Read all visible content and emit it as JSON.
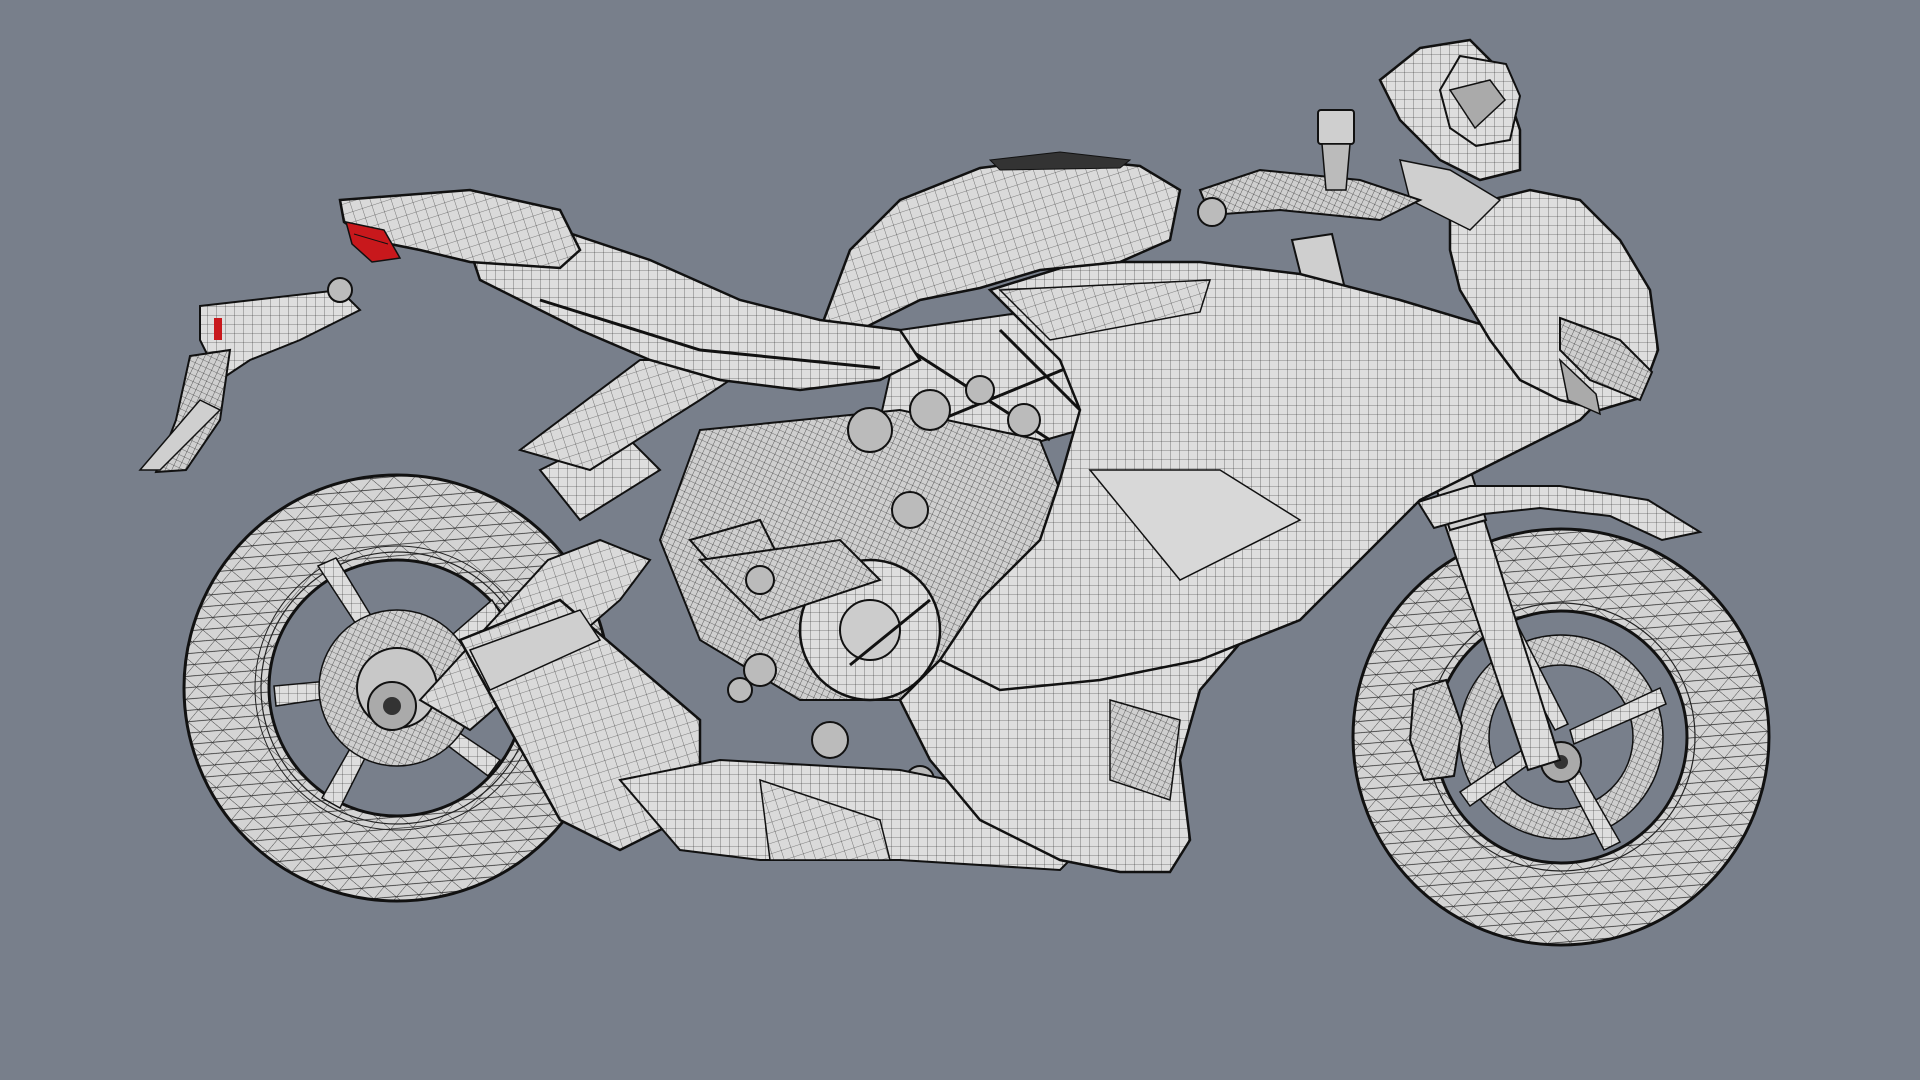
{
  "viewport": {
    "background": "#787f8b",
    "display_mode": "wireframe-shaded",
    "surface_color": "#dedede",
    "wire_color": "#111111",
    "highlight_color": "#c8181c",
    "subject": "motorcycle-model"
  }
}
